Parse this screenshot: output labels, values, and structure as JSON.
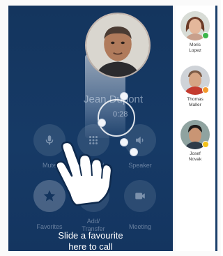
{
  "call": {
    "caller_name": "Jean Dupont",
    "timer": "0:28"
  },
  "controls": [
    {
      "label": "Mute",
      "icon": "microphone-icon"
    },
    {
      "label": "Keypad",
      "icon": "keypad-icon"
    },
    {
      "label": "Speaker",
      "icon": "speaker-icon"
    },
    {
      "label": "Favorites",
      "icon": "star-icon"
    },
    {
      "label": "Add/\nTransfer",
      "icon": "add-call-icon"
    },
    {
      "label": "Meeting",
      "icon": "video-camera-icon"
    }
  ],
  "hint": {
    "line1": "Slide a favourite",
    "line2": "here to call"
  },
  "favorites": [
    {
      "first": "Moris",
      "last": "Lopez",
      "status": "available",
      "status_color": "#3bb54a"
    },
    {
      "first": "Thomas",
      "last": "Maller",
      "status": "away",
      "status_color": "#f39a2d"
    },
    {
      "first": "Josef",
      "last": "Novak",
      "status": "busy",
      "status_color": "#f2c21a"
    }
  ],
  "colors": {
    "call_background": "#163a66",
    "sidebar_background": "#ffffff",
    "accent_edge": "#1b3f6b"
  }
}
